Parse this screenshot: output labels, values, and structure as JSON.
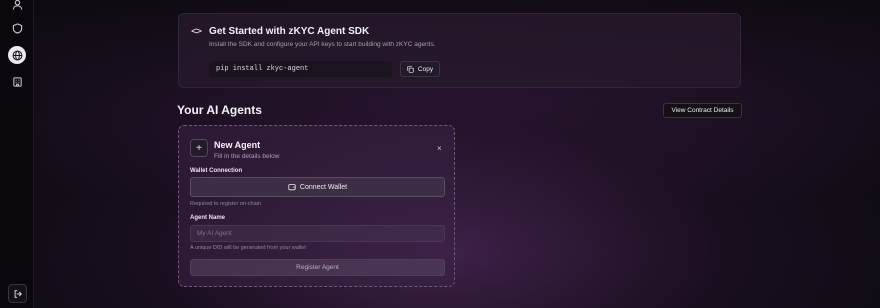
{
  "sidebar": {
    "icons": [
      "user-icon",
      "shield-icon",
      "globe-icon",
      "building-icon",
      "logout-icon"
    ]
  },
  "sdk": {
    "title": "Get Started with zKYC Agent SDK",
    "description": "Install the SDK and configure your API keys to start building with zKYC agents.",
    "command": "pip install zkyc-agent",
    "copy_label": "Copy"
  },
  "agents": {
    "section_title": "Your AI Agents",
    "contract_button": "View Contract Details"
  },
  "new_agent": {
    "title": "New Agent",
    "subtitle": "Fill in the details below",
    "close": "×",
    "wallet_label": "Wallet Connection",
    "connect_button": "Connect Wallet",
    "wallet_hint": "Required to register on-chain",
    "name_label": "Agent Name",
    "name_placeholder": "My AI Agent",
    "name_value": "",
    "did_hint": "A unique DID will be generated from your wallet",
    "register_button": "Register Agent"
  },
  "colors": {
    "background": "#0d0a10",
    "card": "#261a2c",
    "accent_glow": "#683478"
  }
}
